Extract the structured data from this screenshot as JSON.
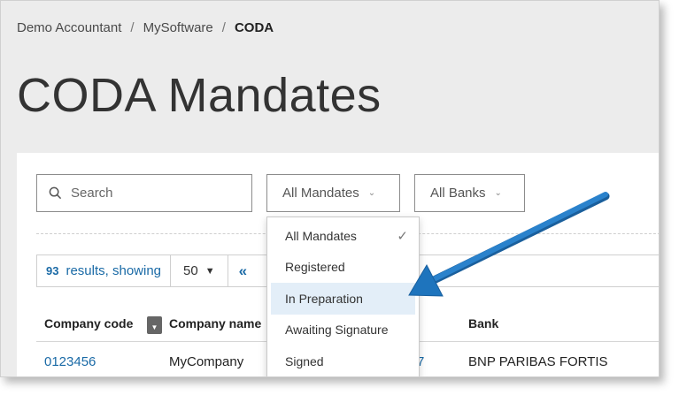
{
  "breadcrumb": {
    "items": [
      "Demo Accountant",
      "MySoftware"
    ],
    "separator": "/",
    "current": "CODA"
  },
  "page": {
    "title": "CODA Mandates"
  },
  "filters": {
    "search_placeholder": "Search",
    "mandates_label": "All Mandates",
    "banks_label": "All Banks"
  },
  "results": {
    "count": "93",
    "text": "results, showing",
    "per_page": "50",
    "first_page": "«"
  },
  "table": {
    "columns": {
      "code": "Company code",
      "name": "Company name",
      "bank": "Bank"
    },
    "rows": [
      {
        "code": "0123456",
        "name": "MyCompany",
        "partial": "7",
        "bank": "BNP PARIBAS FORTIS"
      }
    ]
  },
  "mandate_menu": {
    "options": [
      "All Mandates",
      "Registered",
      "In Preparation",
      "Awaiting Signature",
      "Signed"
    ],
    "selected": "All Mandates",
    "highlighted": "In Preparation"
  },
  "colors": {
    "link": "#1a6aa6",
    "arrow": "#1e74bd",
    "highlight": "#e3eef8"
  }
}
